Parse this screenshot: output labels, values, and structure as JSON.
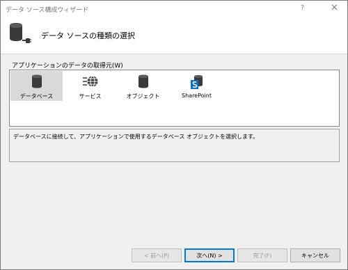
{
  "window": {
    "title": "データ ソース構成ウィザード",
    "help_glyph": "?",
    "close_glyph": "✕"
  },
  "header": {
    "heading": "データ ソースの種類の選択"
  },
  "source_list": {
    "label": "アプリケーションのデータの取得元(W)",
    "items": [
      {
        "label": "データベース",
        "icon": "database-icon",
        "selected": true
      },
      {
        "label": "サービス",
        "icon": "service-globe-icon",
        "selected": false
      },
      {
        "label": "オブジェクト",
        "icon": "object-cylinder-icon",
        "selected": false
      },
      {
        "label": "SharePoint",
        "icon": "sharepoint-icon",
        "selected": false
      }
    ]
  },
  "description": {
    "text": "データベースに接続して、アプリケーションで使用するデータベース オブジェクトを選択します。"
  },
  "buttons": {
    "back": "< 前へ(P)",
    "next": "次へ(N) >",
    "finish": "完了(F)",
    "cancel": "キャンセル"
  },
  "colors": {
    "accent": "#0078d7",
    "sharepoint": "#0f6fc6",
    "icon_dark": "#3a3a3a",
    "selected_bg": "#d9d9d9"
  }
}
